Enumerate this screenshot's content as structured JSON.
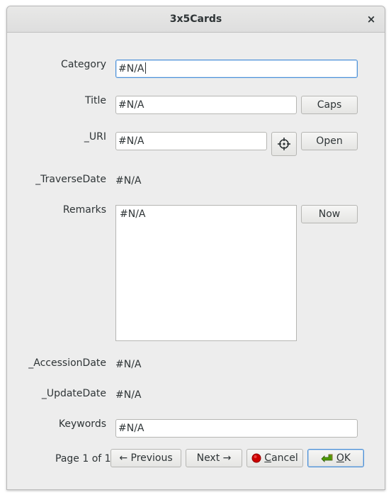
{
  "window": {
    "title": "3x5Cards",
    "close_glyph": "×"
  },
  "fields": {
    "category": {
      "label": "Category",
      "value": "#N/A"
    },
    "title": {
      "label": "Title",
      "value": "#N/A",
      "button": "Caps"
    },
    "uri": {
      "label": "_URI",
      "value": "#N/A",
      "pick_icon": "crosshair-icon",
      "button": "Open"
    },
    "traverse_date": {
      "label": "_TraverseDate",
      "value": "#N/A"
    },
    "remarks": {
      "label": "Remarks",
      "value": "#N/A",
      "button": "Now"
    },
    "accession_date": {
      "label": "_AccessionDate",
      "value": "#N/A"
    },
    "update_date": {
      "label": "_UpdateDate",
      "value": "#N/A"
    },
    "keywords": {
      "label": "Keywords",
      "value": "#N/A"
    }
  },
  "footer": {
    "page_info": "Page 1 of 1",
    "previous": "← Previous",
    "next": "Next →",
    "cancel_first": "C",
    "cancel_rest": "ancel",
    "cancel_icon": "red-circle-icon",
    "ok_first": "O",
    "ok_rest": "K",
    "ok_icon": "green-check-arrow-icon"
  },
  "colors": {
    "focus": "#4a90d9",
    "cancel_icon": "#cc0000",
    "ok_icon": "#4e9a06"
  }
}
